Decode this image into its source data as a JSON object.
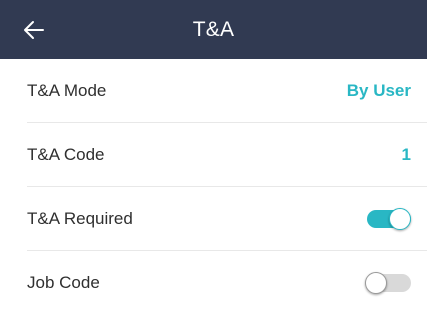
{
  "header": {
    "title": "T&A",
    "back_icon": "arrow-left-icon",
    "background_color": "#313a52"
  },
  "settings": {
    "accent_color": "#29b7c4",
    "rows": [
      {
        "label": "T&A Mode",
        "value": "By User"
      },
      {
        "label": "T&A Code",
        "value": "1"
      },
      {
        "label": "T&A Required",
        "toggle_on": true
      },
      {
        "label": "Job Code",
        "toggle_on": false
      }
    ]
  }
}
